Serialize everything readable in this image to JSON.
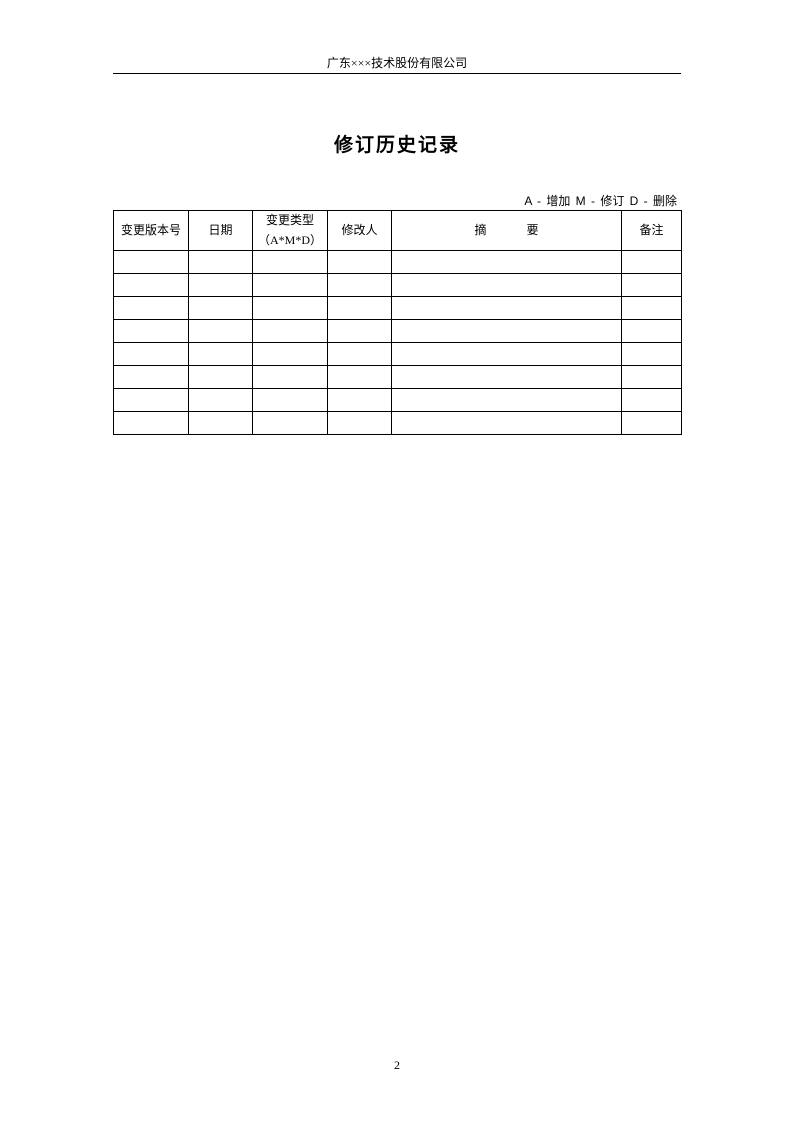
{
  "header": {
    "company": "广东×××技术股份有限公司"
  },
  "title": "修订历史记录",
  "legend": "A - 增加   M - 修订   D - 删除",
  "table": {
    "headers": {
      "version": "变更版本号",
      "date": "日期",
      "type_line1": "变更类型",
      "type_line2": "（A*M*D）",
      "modifier": "修改人",
      "summary": "摘要",
      "note": "备注"
    },
    "rows": [
      {
        "version": "",
        "date": "",
        "type": "",
        "modifier": "",
        "summary": "",
        "note": ""
      },
      {
        "version": "",
        "date": "",
        "type": "",
        "modifier": "",
        "summary": "",
        "note": ""
      },
      {
        "version": "",
        "date": "",
        "type": "",
        "modifier": "",
        "summary": "",
        "note": ""
      },
      {
        "version": "",
        "date": "",
        "type": "",
        "modifier": "",
        "summary": "",
        "note": ""
      },
      {
        "version": "",
        "date": "",
        "type": "",
        "modifier": "",
        "summary": "",
        "note": ""
      },
      {
        "version": "",
        "date": "",
        "type": "",
        "modifier": "",
        "summary": "",
        "note": ""
      },
      {
        "version": "",
        "date": "",
        "type": "",
        "modifier": "",
        "summary": "",
        "note": ""
      },
      {
        "version": "",
        "date": "",
        "type": "",
        "modifier": "",
        "summary": "",
        "note": ""
      }
    ]
  },
  "page_number": "2"
}
